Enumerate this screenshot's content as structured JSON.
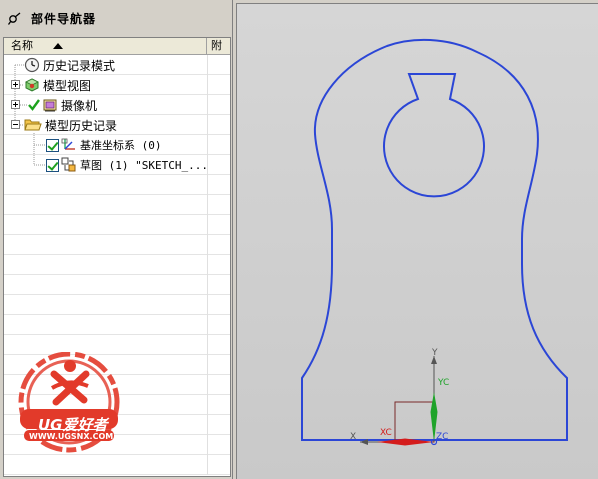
{
  "navigator": {
    "title": "部件导航器",
    "columns": {
      "name": "名称",
      "attr": "附"
    },
    "items": [
      {
        "label": "历史记录模式",
        "icon": "clock-icon"
      },
      {
        "label": "模型视图",
        "icon": "model-views-icon"
      },
      {
        "label": "摄像机",
        "icon": "camera-icon"
      },
      {
        "label": "模型历史记录",
        "icon": "folder-open-icon"
      },
      {
        "label": "基准坐标系 (0)",
        "icon": "datum-csys-icon"
      },
      {
        "label": "草图 (1) \"SKETCH_...",
        "icon": "sketch-icon"
      }
    ]
  },
  "watermark": {
    "brand": "UG爱好者",
    "url": "WWW.UGSNX.COM"
  },
  "graphics": {
    "axis_labels": {
      "y": "Y",
      "yc": "YC",
      "x": "X",
      "xc": "XC",
      "zc": "ZC"
    },
    "colors": {
      "sketch": "#2b46d6",
      "yc_axis": "#1fa32a",
      "xc_axis": "#d41c1c",
      "zc_axis": "#2b46d6"
    }
  }
}
